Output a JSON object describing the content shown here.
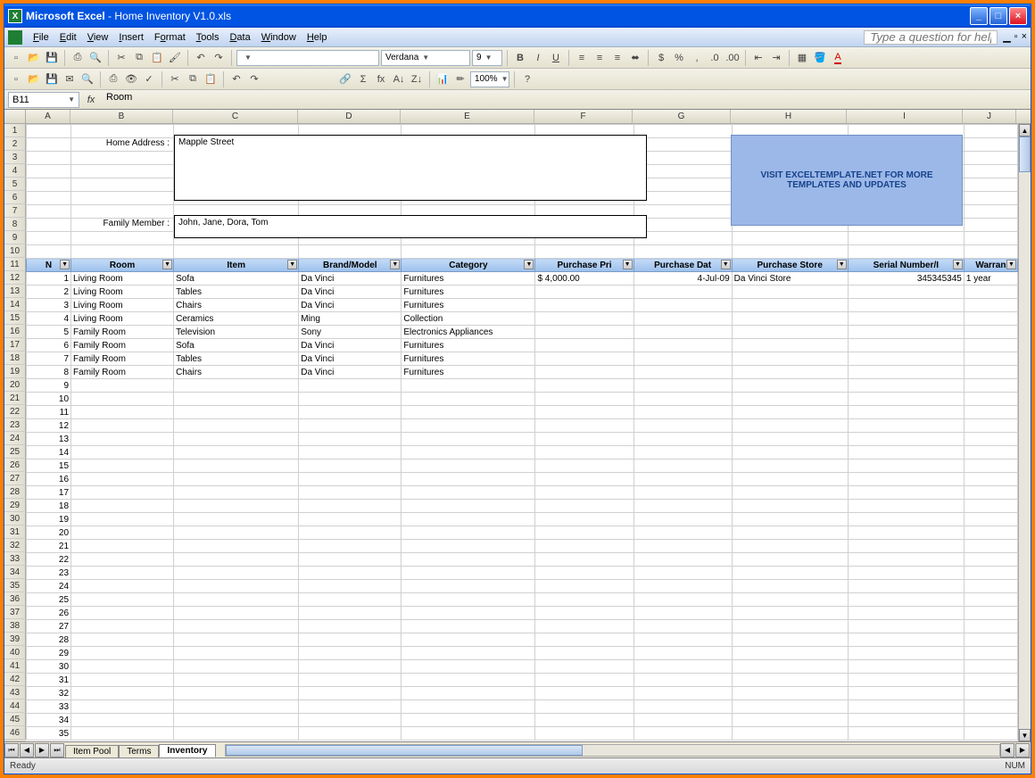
{
  "title": {
    "app": "Microsoft Excel",
    "doc": "Home Inventory V1.0.xls"
  },
  "menu": {
    "file": "File",
    "edit": "Edit",
    "view": "View",
    "insert": "Insert",
    "format": "Format",
    "tools": "Tools",
    "data": "Data",
    "window": "Window",
    "help": "Help",
    "question_placeholder": "Type a question for help"
  },
  "toolbar": {
    "font": "Verdana",
    "size": "9",
    "zoom": "100%"
  },
  "namebox": {
    "ref": "B11",
    "formula": "Room"
  },
  "cols": [
    "A",
    "B",
    "C",
    "D",
    "E",
    "F",
    "G",
    "H",
    "I",
    "J"
  ],
  "form": {
    "home_addr_label": "Home Address :",
    "home_addr_value": "Mapple Street",
    "family_label": "Family Member :",
    "family_value": "John, Jane, Dora, Tom",
    "promo": "VISIT EXCELTEMPLATE.NET FOR MORE TEMPLATES AND UPDATES"
  },
  "filter_headers": [
    "N",
    "Room",
    "Item",
    "Brand/Model",
    "Category",
    "Purchase Pri",
    "Purchase Dat",
    "Purchase Store",
    "Serial Number/I",
    "Warran"
  ],
  "rows": [
    {
      "n": "1",
      "room": "Living Room",
      "item": "Sofa",
      "brand": "Da Vinci",
      "cat": "Furnitures",
      "price": "$        4,000.00",
      "date": "4-Jul-09",
      "store": "Da Vinci Store",
      "serial": "345345345",
      "war": "1 year"
    },
    {
      "n": "2",
      "room": "Living Room",
      "item": "Tables",
      "brand": "Da Vinci",
      "cat": "Furnitures",
      "price": "",
      "date": "",
      "store": "",
      "serial": "",
      "war": ""
    },
    {
      "n": "3",
      "room": "Living Room",
      "item": "Chairs",
      "brand": "Da Vinci",
      "cat": "Furnitures",
      "price": "",
      "date": "",
      "store": "",
      "serial": "",
      "war": ""
    },
    {
      "n": "4",
      "room": "Living Room",
      "item": "Ceramics",
      "brand": "Ming",
      "cat": "Collection",
      "price": "",
      "date": "",
      "store": "",
      "serial": "",
      "war": ""
    },
    {
      "n": "5",
      "room": "Family Room",
      "item": "Television",
      "brand": "Sony",
      "cat": "Electronics Appliances",
      "price": "",
      "date": "",
      "store": "",
      "serial": "",
      "war": ""
    },
    {
      "n": "6",
      "room": "Family Room",
      "item": "Sofa",
      "brand": "Da Vinci",
      "cat": "Furnitures",
      "price": "",
      "date": "",
      "store": "",
      "serial": "",
      "war": ""
    },
    {
      "n": "7",
      "room": "Family Room",
      "item": "Tables",
      "brand": "Da Vinci",
      "cat": "Furnitures",
      "price": "",
      "date": "",
      "store": "",
      "serial": "",
      "war": ""
    },
    {
      "n": "8",
      "room": "Family Room",
      "item": "Chairs",
      "brand": "Da Vinci",
      "cat": "Furnitures",
      "price": "",
      "date": "",
      "store": "",
      "serial": "",
      "war": ""
    }
  ],
  "empty_rows": [
    "9",
    "10",
    "11",
    "12",
    "13",
    "14",
    "15",
    "16",
    "17",
    "18",
    "19",
    "20",
    "21",
    "22",
    "23",
    "24",
    "25",
    "26",
    "27",
    "28",
    "29",
    "30",
    "31",
    "32",
    "33",
    "34",
    "35"
  ],
  "sheets": {
    "s1": "Item Pool",
    "s2": "Terms",
    "s3": "Inventory"
  },
  "status": {
    "ready": "Ready",
    "num": "NUM"
  }
}
